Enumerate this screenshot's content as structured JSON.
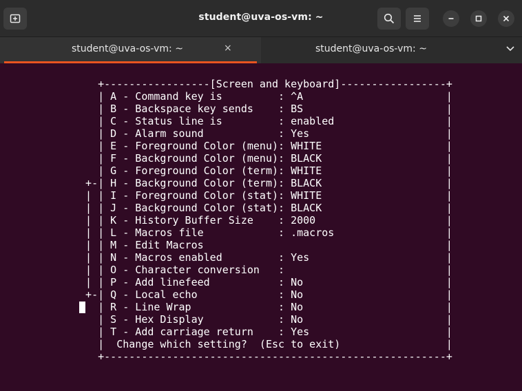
{
  "window": {
    "title": "student@uva-os-vm: ~"
  },
  "icons": {
    "new_tab": "new-tab-icon",
    "search": "search-icon",
    "menu": "hamburger-menu-icon",
    "minimize": "minimize-icon",
    "maximize": "maximize-icon",
    "close": "close-icon",
    "tab_close": "tab-close-icon",
    "tabs_dropdown": "chevron-down-icon"
  },
  "colors": {
    "terminal_bg": "#300a24",
    "titlebar_bg": "#2c2c2c",
    "accent": "#e95420",
    "text": "#ffffff"
  },
  "tabs": [
    {
      "label": "student@uva-os-vm: ~",
      "close": "×",
      "active": true
    },
    {
      "label": "student@uva-os-vm: ~",
      "close": "×",
      "active": false
    }
  ],
  "terminal": {
    "lines": [
      "    +-----------------[Screen and keyboard]-----------------+",
      "    | A - Command key is         : ^A                       |",
      "    | B - Backspace key sends    : BS                       |",
      "    | C - Status line is         : enabled                  |",
      "    | D - Alarm sound            : Yes                      |",
      "    | E - Foreground Color (menu): WHITE                    |",
      "    | F - Background Color (menu): BLACK                    |",
      "    | G - Foreground Color (term): WHITE                    |",
      "  +-| H - Background Color (term): BLACK                    |",
      "  | | I - Foreground Color (stat): WHITE                    |",
      "  | | J - Background Color (stat): BLACK                    |",
      "  | | K - History Buffer Size    : 2000                     |",
      "  | | L - Macros file            : .macros                  |",
      "  | | M - Edit Macros                                       |",
      "  | | N - Macros enabled         : Yes                      |",
      "  | | O - Character conversion   :                          |",
      "  | | P - Add linefeed           : No                       |",
      "  +-| Q - Local echo             : No                       |",
      "    | R - Line Wrap              : No                       |",
      "    | S - Hex Display            : No                       |",
      "    | T - Add carriage return    : Yes                      |",
      "    |  Change which setting?  (Esc to exit)                 |",
      "    +-------------------------------------------------------+"
    ]
  }
}
